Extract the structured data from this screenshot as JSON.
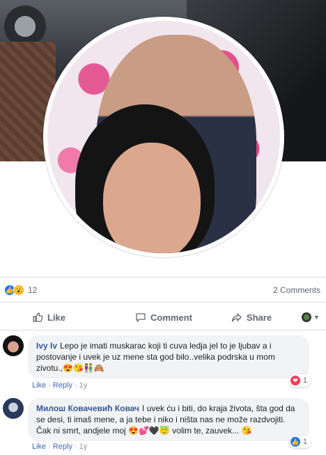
{
  "reactions": {
    "count": "12",
    "comments": "2 Comments"
  },
  "actions": {
    "like": "Like",
    "comment": "Comment",
    "share": "Share"
  },
  "comments": [
    {
      "author": "Ivy Iv",
      "text": "Lepo je imati muskarac koji ti cuva ledja jel to je ljubav a i postovanje i uvek je uz mene sta god bilo..velika podrska u mom zivotu.,😍😘👫🙈",
      "like": "Like",
      "reply": "Reply",
      "time": "1y",
      "reaction_count": "1",
      "reaction_icon": "heart-icon"
    },
    {
      "author": "Милош Ковачевић Ковач",
      "text": "I uvek ću i biti, do kraja života, šta god da se desi, ti imaš mene, a ja tebe i niko i ništa nas ne može razdvojiti. Čak ni smrt, andjele moj 😍💕🖤😇 volim te, zauvek... 😘",
      "like": "Like",
      "reply": "Reply",
      "time": "1y",
      "reaction_count": "1",
      "reaction_icon": "thumbs-up-icon"
    }
  ],
  "colors": {
    "link": "#385898",
    "like_blue": "#1877f2",
    "heart": "#f33e58",
    "muted": "#606770",
    "bubble": "#f2f3f5"
  }
}
